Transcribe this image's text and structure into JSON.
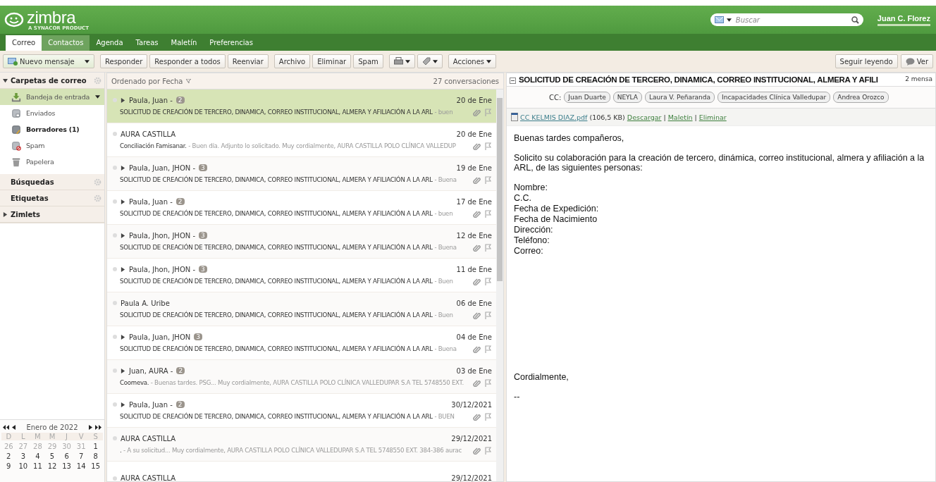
{
  "brand": {
    "name": "zimbra",
    "tagline": "A SYNACOR PRODUCT"
  },
  "search": {
    "placeholder": "Buscar"
  },
  "user": {
    "name": "Juan C. Florez"
  },
  "tabs": [
    {
      "label": "Correo",
      "selected": true,
      "highlighted": false
    },
    {
      "label": "Contactos",
      "selected": false,
      "highlighted": true
    },
    {
      "label": "Agenda",
      "selected": false,
      "highlighted": false
    },
    {
      "label": "Tareas",
      "selected": false,
      "highlighted": false
    },
    {
      "label": "Maletín",
      "selected": false,
      "highlighted": false
    },
    {
      "label": "Preferencias",
      "selected": false,
      "highlighted": false
    }
  ],
  "toolbar": {
    "new_message": "Nuevo mensaje",
    "groups": [
      [
        "Responder",
        "Responder a todos",
        "Reenviar"
      ],
      [
        "Archivo",
        "Eliminar",
        "Spam"
      ]
    ],
    "actions": "Acciones",
    "right": [
      "Seguir leyendo",
      "Ver"
    ]
  },
  "sidebar": {
    "folders_header": "Carpetas de correo",
    "folders": [
      {
        "kind": "inbox",
        "label": "Bandeja de entrada",
        "selected": true,
        "unread": false
      },
      {
        "kind": "sent",
        "label": "Enviados",
        "selected": false,
        "unread": false
      },
      {
        "kind": "drafts",
        "label": "Borradores (1)",
        "selected": false,
        "unread": true
      },
      {
        "kind": "spam",
        "label": "Spam",
        "selected": false,
        "unread": false
      },
      {
        "kind": "trash",
        "label": "Papelera",
        "selected": false,
        "unread": false
      }
    ],
    "sections": [
      {
        "label": "Búsquedas",
        "kind": "gear"
      },
      {
        "label": "Etiquetas",
        "kind": "gear"
      },
      {
        "label": "Zimlets",
        "kind": "collapsed"
      }
    ]
  },
  "calendar": {
    "month": "Enero de 2022",
    "weekdays": [
      "D",
      "L",
      "M",
      "M",
      "J",
      "V",
      "S"
    ],
    "weeks": [
      [
        {
          "day": "26",
          "other_month": true
        },
        {
          "day": "27",
          "other_month": true
        },
        {
          "day": "28",
          "other_month": true
        },
        {
          "day": "29",
          "other_month": true
        },
        {
          "day": "30",
          "other_month": true
        },
        {
          "day": "31",
          "other_month": true
        },
        {
          "day": "1",
          "other_month": false
        }
      ],
      [
        {
          "day": "2",
          "other_month": false
        },
        {
          "day": "3",
          "other_month": false
        },
        {
          "day": "4",
          "other_month": false
        },
        {
          "day": "5",
          "other_month": false
        },
        {
          "day": "6",
          "other_month": false
        },
        {
          "day": "7",
          "other_month": false
        },
        {
          "day": "8",
          "other_month": false
        }
      ],
      [
        {
          "day": "9",
          "other_month": false
        },
        {
          "day": "10",
          "other_month": false
        },
        {
          "day": "11",
          "other_month": false
        },
        {
          "day": "12",
          "other_month": false
        },
        {
          "day": "13",
          "other_month": false
        },
        {
          "day": "14",
          "other_month": false
        },
        {
          "day": "15",
          "other_month": false
        }
      ]
    ]
  },
  "message_list": {
    "sort": "Ordenado por Fecha",
    "count": "27 conversaciones",
    "rows": [
      {
        "kind": "conversation",
        "senders": "Paula, Juan -",
        "badge": "2",
        "date": "20 de Ene",
        "subject": "SOLICITUD DE CREACIÓN DE TERCERO, DINAMICA, CORREO INSTITUCIONAL, ALMERA Y AFILIACIÓN A LA ARL",
        "fragment": "- buen",
        "selected": true
      },
      {
        "kind": "message",
        "senders": "AURA CASTILLA",
        "date": "20 de Ene",
        "subject": "Conciliación Famisanar.",
        "fragment": "- Buen día. Adjunto lo solicitado. Muy cordialmente, AURA CASTILLA POLO CLÍNICA VALLEDUP",
        "selected": false
      },
      {
        "kind": "conversation",
        "senders": "Paula, Juan, JHON -",
        "badge": "3",
        "date": "19 de Ene",
        "subject": "SOLICITUD DE CREACIÓN DE TERCERO, DINAMICA, CORREO INSTITUCIONAL, ALMERA Y AFILIACIÓN A LA ARL",
        "fragment": "- Buena",
        "selected": false
      },
      {
        "kind": "conversation",
        "senders": "Paula, Juan -",
        "badge": "2",
        "date": "17 de Ene",
        "subject": "SOLICITUD DE CREACIÓN DE TERCERO, DINAMICA, CORREO INSTITUCIONAL, ALMERA Y AFILIACIÓN A LA ARL",
        "fragment": "- buen",
        "selected": false
      },
      {
        "kind": "conversation",
        "senders": "Paula, Jhon, JHON -",
        "badge": "3",
        "date": "12 de Ene",
        "subject": "SOLICITUD DE CREACIÓN DE TERCERO, DINAMICA, CORREO INSTITUCIONAL, ALMERA Y AFILIACIÓN A LA ARL",
        "fragment": "- Buena",
        "selected": false
      },
      {
        "kind": "conversation",
        "senders": "Paula, Jhon, JHON -",
        "badge": "3",
        "date": "11 de Ene",
        "subject": "SOLICITUD DE CREACIÓN DE TERCERO, DINAMICA, CORREO INSTITUCIONAL, ALMERA Y AFILIACIÓN A LA ARL",
        "fragment": "- Buen",
        "selected": false
      },
      {
        "kind": "message",
        "senders": "Paula A. Uribe",
        "date": "06 de Ene",
        "subject": "SOLICITUD DE CREACIÓN DE TERCERO, DINAMICA, CORREO INSTITUCIONAL, ALMERA Y AFILIACIÓN A LA ARL",
        "fragment": "- Buen",
        "selected": false
      },
      {
        "kind": "conversation",
        "senders": "Paula, Juan, JHON",
        "badge": "3",
        "date": "04 de Ene",
        "subject": "SOLICITUD DE CREACIÓN DE TERCERO, DINAMICA, CORREO INSTITUCIONAL, ALMERA Y AFILIACIÓN A LA ARL",
        "fragment": "- Buena",
        "selected": false
      },
      {
        "kind": "conversation",
        "senders": "Juan, AURA -",
        "badge": "2",
        "date": "03 de Ene",
        "subject": "Coomeva.",
        "fragment": "- Buenas tardes. PSG... Muy cordialmente, AURA CASTILLA POLO CLÍNICA VALLEDUPAR S.A TEL 5748550 EXT.",
        "selected": false
      },
      {
        "kind": "conversation",
        "senders": "Paula, Juan -",
        "badge": "2",
        "date": "30/12/2021",
        "subject": "SOLICITUD DE CREACIÓN DE TERCERO, DINAMICA, CORREO INSTITUCIONAL, ALMERA Y AFILIACIÓN A LA ARL",
        "fragment": "- BUEN",
        "selected": false
      },
      {
        "kind": "message",
        "senders": "AURA CASTILLA",
        "date": "29/12/2021",
        "subject": ".",
        "fragment": "- A su solicitud... Muy cordialmente, AURA CASTILLA POLO CLÍNICA VALLEDUPAR S.A TEL 5748550 EXT. 384-386 aurac",
        "selected": false
      },
      {
        "kind": "message",
        "senders": "AURA CASTILLA",
        "date": "29/12/2021",
        "selected": false
      }
    ]
  },
  "reading_pane": {
    "subject": "SOLICITUD DE CREACIÓN DE TERCERO, DINAMICA, CORREO INSTITUCIONAL, ALMERA Y AFILI",
    "message_count": "2 mensa",
    "cc_label": "CC:",
    "cc": [
      "Juan Duarte",
      "NEYLA",
      "Laura V. Peñaranda",
      "Incapacidades Clínica Valledupar",
      "Andrea Orozco"
    ],
    "attachment": {
      "name": "CC KELMIS DIAZ.pdf",
      "size": "(106,5 KB)",
      "links": [
        "Descargar",
        "Maletín",
        "Eliminar"
      ],
      "separator": "|"
    },
    "body": [
      {
        "kind": "paragraph",
        "text": "Buenas tardes compañeros,"
      },
      {
        "kind": "paragraph",
        "text": "Solicito su colaboración para la creación de tercero, dinámica, correo institucional, almera y afiliación a la ARL, de las siguientes personas:"
      },
      {
        "kind": "lines",
        "lines": [
          "Nombre:",
          "C.C.",
          "Fecha de Expedición:",
          "Fecha de Nacimiento",
          "Dirección:",
          "Teléfono:",
          "Correo:"
        ]
      },
      {
        "kind": "spacer"
      },
      {
        "kind": "paragraph",
        "text": "Cordialmente,"
      },
      {
        "kind": "paragraph",
        "text": "--"
      }
    ]
  }
}
